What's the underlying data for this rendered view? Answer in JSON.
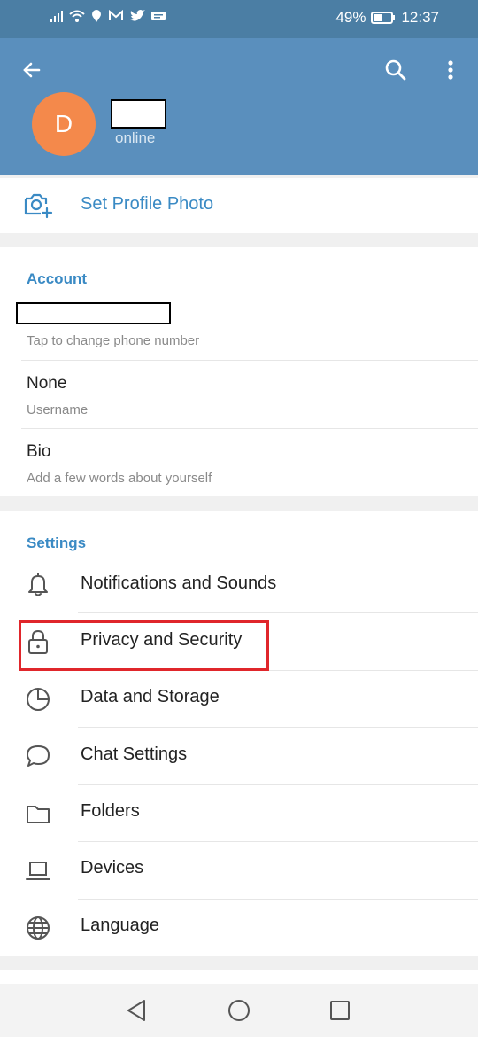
{
  "status_bar": {
    "battery": "49%",
    "time": "12:37"
  },
  "header": {
    "avatar_initial": "D",
    "status": "online",
    "back_icon": "arrow-left-icon",
    "search_icon": "search-icon",
    "menu_icon": "more-vertical-icon",
    "header_color": "#5a8fbd",
    "avatar_color": "#f4894b"
  },
  "set_photo": {
    "label": "Set Profile Photo",
    "icon": "camera-add-icon"
  },
  "account": {
    "title": "Account",
    "phone_hint": "Tap to change phone number",
    "username_value": "None",
    "username_label": "Username",
    "bio_value": "Bio",
    "bio_hint": "Add a few words about yourself"
  },
  "settings": {
    "title": "Settings",
    "items": [
      {
        "label": "Notifications and Sounds",
        "icon": "bell-icon"
      },
      {
        "label": "Privacy and Security",
        "icon": "lock-icon"
      },
      {
        "label": "Data and Storage",
        "icon": "pie-chart-icon"
      },
      {
        "label": "Chat Settings",
        "icon": "chat-bubble-icon"
      },
      {
        "label": "Folders",
        "icon": "folder-icon"
      },
      {
        "label": "Devices",
        "icon": "laptop-icon"
      },
      {
        "label": "Language",
        "icon": "globe-icon"
      }
    ]
  },
  "accent_color": "#3a8ac4",
  "highlight_color": "#e0262b"
}
